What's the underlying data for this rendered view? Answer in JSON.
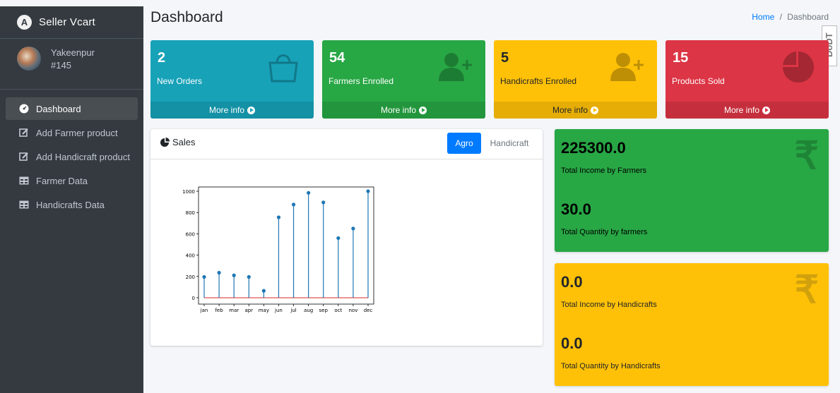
{
  "brand": {
    "name": "Seller Vcart",
    "logo_letter": "A"
  },
  "user": {
    "name": "Yakeenpur",
    "id": "#145"
  },
  "nav": [
    {
      "label": "Dashboard",
      "icon": "tachometer-icon"
    },
    {
      "label": "Add Farmer product",
      "icon": "edit-icon"
    },
    {
      "label": "Add Handicraft product",
      "icon": "edit-icon"
    },
    {
      "label": "Farmer Data",
      "icon": "table-icon"
    },
    {
      "label": "Handicrafts Data",
      "icon": "table-icon"
    }
  ],
  "header": {
    "title": "Dashboard",
    "breadcrumb_home": "Home",
    "breadcrumb_sep": "/",
    "breadcrumb_current": "Dashboard",
    "watermark": "DoDT"
  },
  "stats": [
    {
      "value": "2",
      "label": "New Orders",
      "more": "More info",
      "icon": "shopping-bag-icon",
      "color": "#17a2b8"
    },
    {
      "value": "54",
      "label": "Farmers Enrolled",
      "more": "More info",
      "icon": "user-plus-icon",
      "color": "#28a745"
    },
    {
      "value": "5",
      "label": "Handicrafts Enrolled",
      "more": "More info",
      "icon": "user-plus-icon",
      "color": "#ffc107"
    },
    {
      "value": "15",
      "label": "Products Sold",
      "more": "More info",
      "icon": "pie-chart-icon",
      "color": "#dc3545"
    }
  ],
  "sales": {
    "title": "Sales",
    "tabs": [
      "Agro",
      "Handicraft"
    ],
    "active_tab": "Agro"
  },
  "summary": {
    "farmers": {
      "income": "225300.0",
      "income_label": "Total Income by Farmers",
      "qty": "30.0",
      "qty_label": "Total Quantity by farmers",
      "icon": "rupee-icon",
      "symbol": "₹"
    },
    "handicrafts": {
      "income": "0.0",
      "income_label": "Total Income by Handicrafts",
      "qty": "0.0",
      "qty_label": "Total Quantity by Handicrafts",
      "icon": "rupee-icon",
      "symbol": "₹"
    }
  },
  "chart_data": {
    "type": "stem",
    "categories": [
      "jan",
      "feb",
      "mar",
      "apr",
      "may",
      "jun",
      "jul",
      "aug",
      "sep",
      "oct",
      "nov",
      "dec"
    ],
    "values": [
      195,
      235,
      210,
      195,
      65,
      755,
      875,
      985,
      895,
      560,
      650,
      1000
    ],
    "ylim": [
      -60,
      1040
    ],
    "yticks": [
      0,
      200,
      400,
      600,
      800,
      1000
    ],
    "colors": {
      "stem": "#1f77b4",
      "baseline": "#d62728"
    }
  }
}
